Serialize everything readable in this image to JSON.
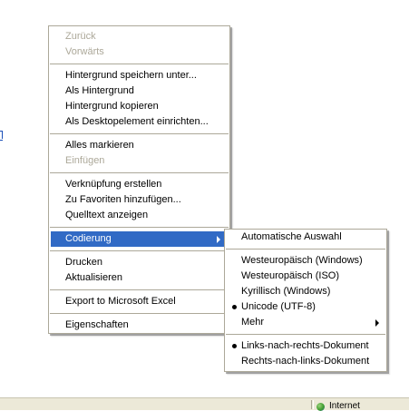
{
  "context_menu": {
    "items": [
      {
        "label": "Zurück"
      },
      {
        "label": "Vorwärts"
      },
      {
        "label": "Hintergrund speichern unter..."
      },
      {
        "label": "Als Hintergrund"
      },
      {
        "label": "Hintergrund kopieren"
      },
      {
        "label": "Als Desktopelement einrichten..."
      },
      {
        "label": "Alles markieren"
      },
      {
        "label": "Einfügen"
      },
      {
        "label": "Verknüpfung erstellen"
      },
      {
        "label": "Zu Favoriten hinzufügen..."
      },
      {
        "label": "Quelltext anzeigen"
      },
      {
        "label": "Codierung"
      },
      {
        "label": "Drucken"
      },
      {
        "label": "Aktualisieren"
      },
      {
        "label": "Export to Microsoft Excel"
      },
      {
        "label": "Eigenschaften"
      }
    ],
    "disabled_items": [
      "Zurück",
      "Vorwärts",
      "Einfügen"
    ],
    "highlighted_item": "Codierung"
  },
  "submenu": {
    "items": [
      {
        "label": "Automatische Auswahl"
      },
      {
        "label": "Westeuropäisch (Windows)"
      },
      {
        "label": "Westeuropäisch (ISO)"
      },
      {
        "label": "Kyrillisch (Windows)"
      },
      {
        "label": "Unicode (UTF-8)"
      },
      {
        "label": "Mehr"
      },
      {
        "label": "Links-nach-rechts-Dokument"
      },
      {
        "label": "Rechts-nach-links-Dokument"
      }
    ],
    "selected_items": [
      "Unicode (UTF-8)",
      "Links-nach-rechts-Dokument"
    ]
  },
  "statusbar": {
    "zone_text": "Internet"
  },
  "icons": {
    "submenu_arrow": "chevron-right-icon",
    "selection_bullet": "bullet-icon",
    "zone": "internet-zone-icon"
  },
  "colors": {
    "highlight": "#316ac5",
    "disabled_text": "#aca899",
    "menu_border": "#aca899",
    "statusbar_bg": "#ece9d8"
  }
}
